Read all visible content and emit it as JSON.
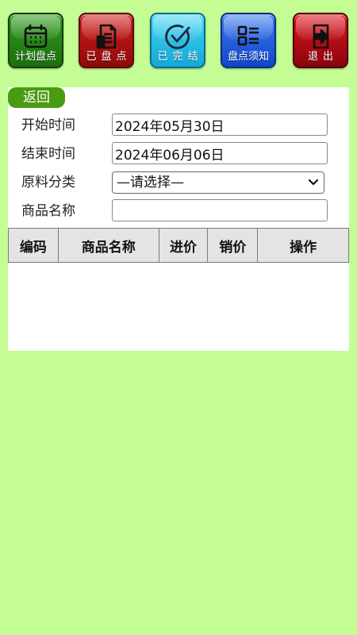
{
  "toolbar": {
    "buttons": [
      {
        "label": "计划盘点",
        "icon": "calendar-icon"
      },
      {
        "label": "已盘点",
        "icon": "document-icon"
      },
      {
        "label": "已完结",
        "icon": "check-circle-icon"
      },
      {
        "label": "盘点须知",
        "icon": "list-icon"
      },
      {
        "label": "退出",
        "icon": "exit-icon"
      }
    ]
  },
  "form": {
    "back_label": "返回",
    "start_label": "开始时间",
    "start_value": "2024年05月30日",
    "end_label": "结束时间",
    "end_value": "2024年06月06日",
    "category_label": "原料分类",
    "category_selected": "—请选择—",
    "product_label": "商品名称",
    "product_value": ""
  },
  "table": {
    "headers": [
      "编码",
      "商品名称",
      "进价",
      "销价",
      "操作"
    ],
    "rows": []
  },
  "colors": {
    "background": "#c5fd95",
    "back_button": "#4a9b12",
    "header_bg": "#e4e4e4"
  }
}
